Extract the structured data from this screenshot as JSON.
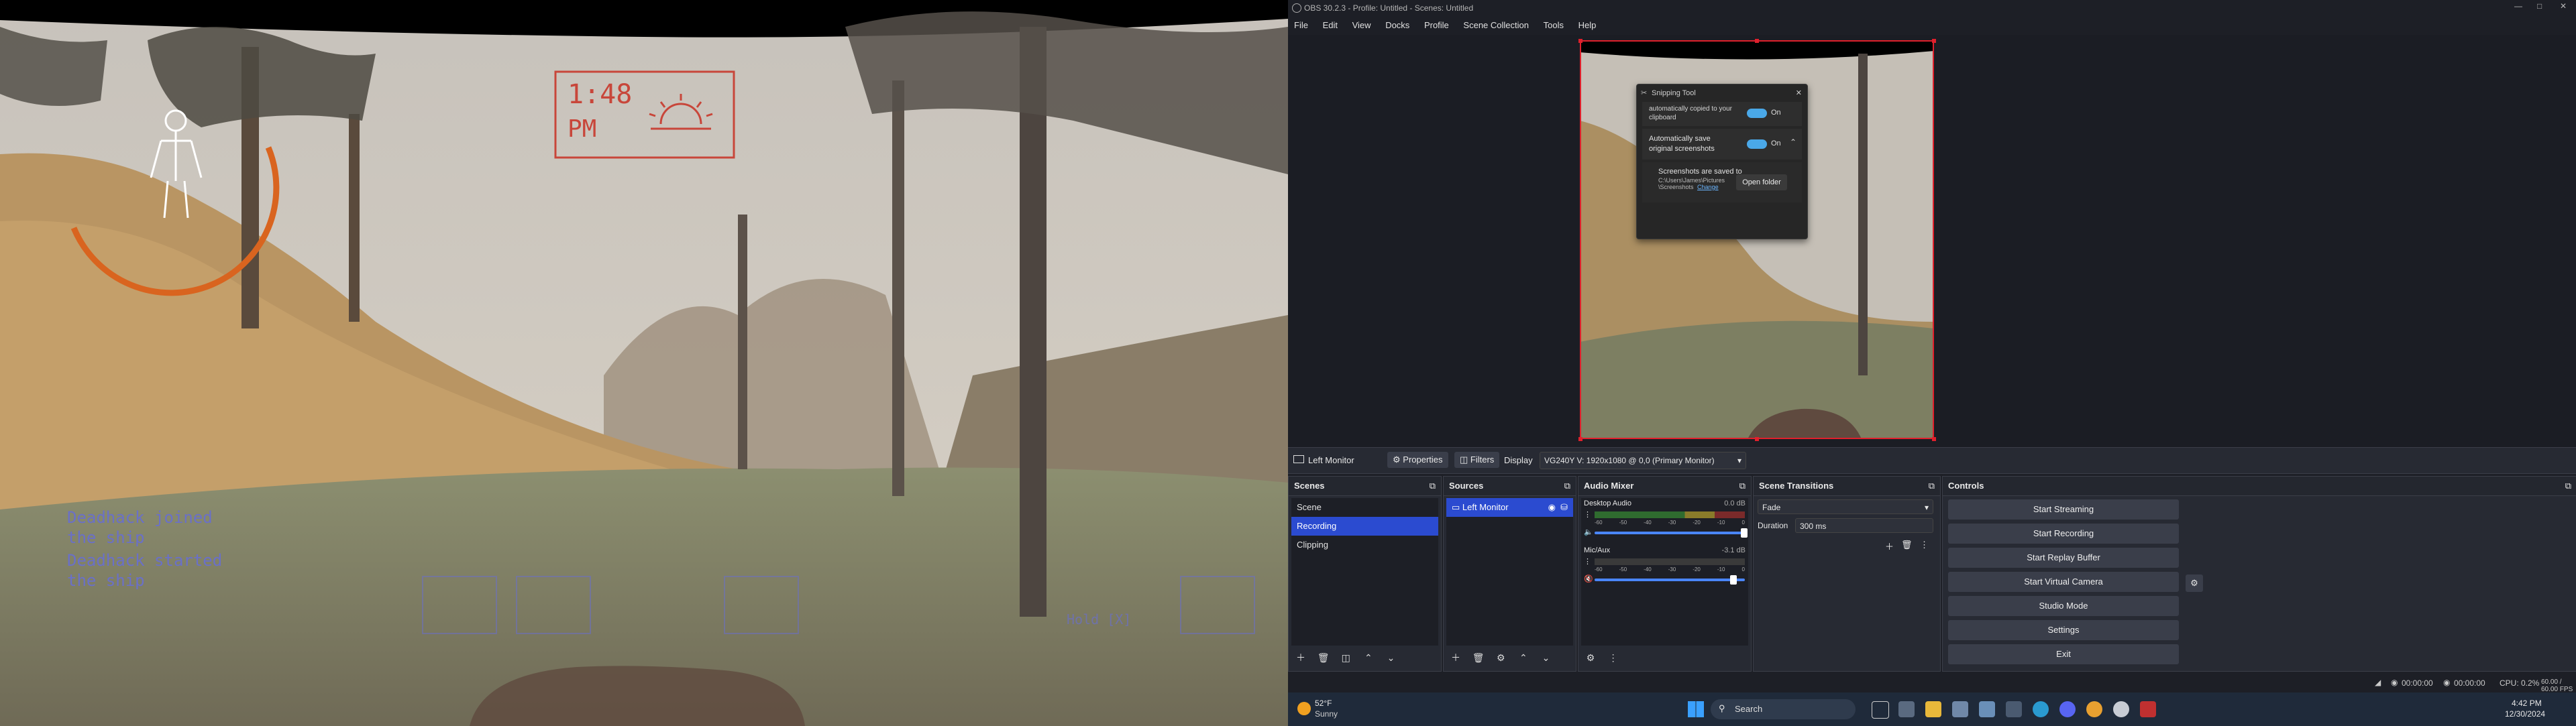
{
  "game": {
    "hud_time_line1": "1:48",
    "hud_time_line2": "PM",
    "log_1a": "Deadhack joined",
    "log_1b": "the ship",
    "log_2a": "Deadhack started",
    "log_2b": "the ship",
    "hold_hint": "Hold [X]",
    "colors": {
      "hud_red": "#c8463a",
      "hud_orange": "#d9641f",
      "hud_blue": "#6a70c8"
    }
  },
  "obs": {
    "title": "OBS 30.2.3 - Profile: Untitled - Scenes: Untitled",
    "menu": [
      "File",
      "Edit",
      "View",
      "Docks",
      "Profile",
      "Scene Collection",
      "Tools",
      "Help"
    ],
    "snip": {
      "title": "Snipping Tool",
      "row0_partial": "automatically copied to your clipboard",
      "row0_state": "On",
      "row1_label": "Automatically save original screenshots",
      "row1_state": "On",
      "row2_label": "Screenshots are saved to",
      "row2_path_a": "C:\\Users\\James\\Pictures",
      "row2_path_b": "\\Screenshots",
      "row2_change": "Change",
      "open_folder": "Open folder"
    },
    "source_bar": {
      "source": "Left Monitor",
      "properties": "Properties",
      "filters": "Filters",
      "display_label": "Display",
      "display_value": "VG240Y V: 1920x1080 @ 0,0 (Primary Monitor)"
    },
    "scenes": {
      "title": "Scenes",
      "items": [
        "Scene",
        "Recording",
        "Clipping"
      ],
      "selected": 1
    },
    "sources": {
      "title": "Sources",
      "items": [
        "Left Monitor"
      ]
    },
    "mixer": {
      "title": "Audio Mixer",
      "ch1_name": "Desktop Audio",
      "ch1_db": "0.0 dB",
      "ch2_name": "Mic/Aux",
      "ch2_db": "-3.1 dB",
      "scale": [
        "-60",
        "-55",
        "-50",
        "-45",
        "-40",
        "-35",
        "-30",
        "-25",
        "-20",
        "-15",
        "-10",
        "-5",
        "0"
      ]
    },
    "transitions": {
      "title": "Scene Transitions",
      "type": "Fade",
      "duration_label": "Duration",
      "duration_value": "300 ms"
    },
    "controls": {
      "title": "Controls",
      "buttons": [
        "Start Streaming",
        "Start Recording",
        "Start Replay Buffer",
        "Start Virtual Camera",
        "Studio Mode",
        "Settings",
        "Exit"
      ]
    },
    "status": {
      "rec_time": "00:00:00",
      "stream_time": "00:00:00",
      "cpu": "CPU: 0.2%",
      "fps": "60.00 / 60.00 FPS"
    }
  },
  "taskbar": {
    "weather_temp": "52°F",
    "weather_desc": "Sunny",
    "search": "Search",
    "time": "4:42 PM",
    "date": "12/30/2024"
  }
}
